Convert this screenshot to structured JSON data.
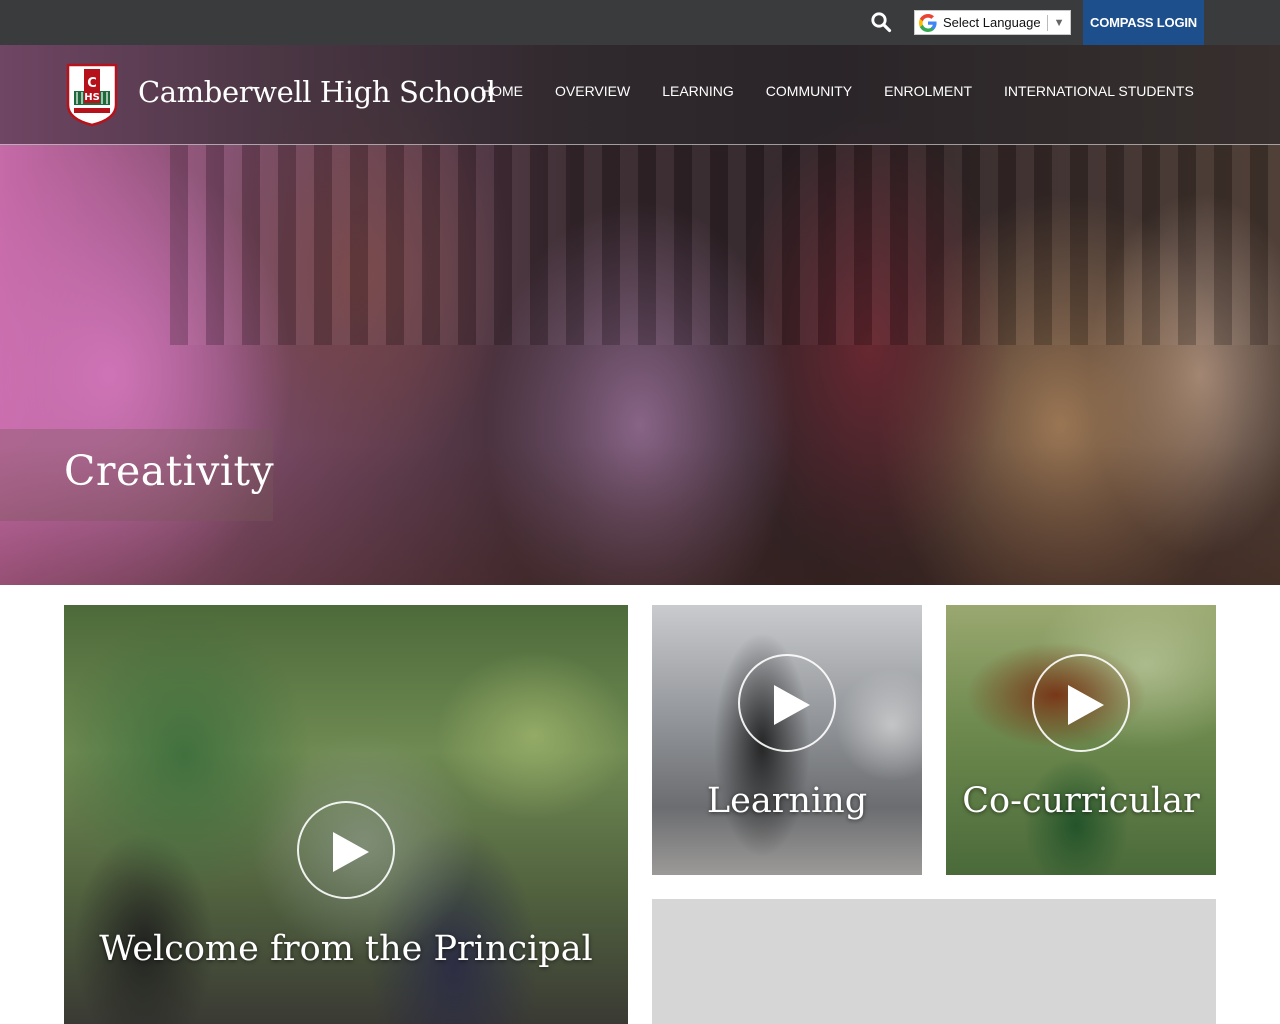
{
  "topbar": {
    "search_icon": "search-icon",
    "language_label": "Select Language",
    "language_arrow": "▼",
    "compass_label": "COMPASS LOGIN",
    "compass_color": "#1d4f8c"
  },
  "header": {
    "school_name": "Camberwell High School",
    "logo_icon": "school-crest-logo",
    "nav": [
      "HOME",
      "OVERVIEW",
      "LEARNING",
      "COMMUNITY",
      "ENROLMENT",
      "INTERNATIONAL STUDENTS"
    ]
  },
  "hero": {
    "caption": "Creativity"
  },
  "tiles": {
    "principal": {
      "label": "Welcome from the Principal",
      "icon": "play-icon"
    },
    "learning": {
      "label": "Learning",
      "icon": "play-icon"
    },
    "cocurricular": {
      "label": "Co-curricular",
      "icon": "play-icon"
    }
  }
}
